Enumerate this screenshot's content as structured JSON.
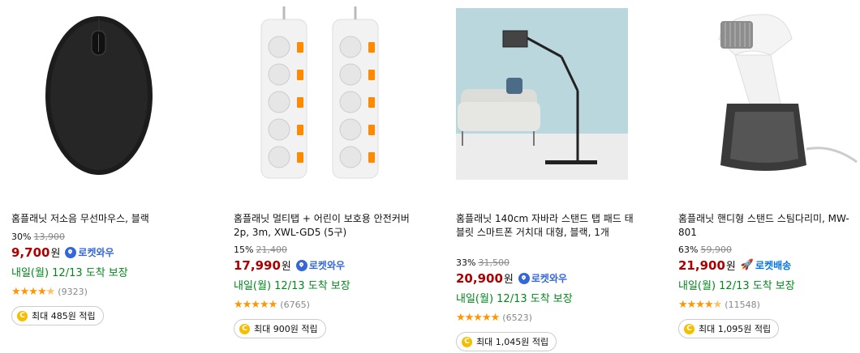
{
  "products": [
    {
      "image_icon": "wireless-mouse-image",
      "title": "홈플래닛 저소음 무선마우스, 블랙",
      "discount": "30%",
      "original_price": "13,900",
      "price": "9,700",
      "won": "원",
      "badge": "로켓와우",
      "delivery": "내일(월) 12/13 도착 보장",
      "rating": 4.5,
      "reviews": "(9323)",
      "reward": "최대 485원 적립"
    },
    {
      "image_icon": "power-strip-image",
      "title": "홈플래닛 멀티탭 + 어린이 보호용 안전커버 2p, 3m, XWL-GD5 (5구)",
      "discount": "15%",
      "original_price": "21,400",
      "price": "17,990",
      "won": "원",
      "badge": "로켓와우",
      "delivery": "내일(월) 12/13 도착 보장",
      "rating": 5,
      "reviews": "(6765)",
      "reward": "최대 900원 적립"
    },
    {
      "image_icon": "tablet-stand-image",
      "title": "홈플래닛 140cm 자바라 스탠드 탭 패드 태블릿 스마트폰 거치대 대형, 블랙, 1개",
      "discount": "33%",
      "original_price": "31,500",
      "price": "20,900",
      "won": "원",
      "badge": "로켓와우",
      "delivery": "내일(월) 12/13 도착 보장",
      "rating": 5,
      "reviews": "(6523)",
      "reward": "최대 1,045원 적립"
    },
    {
      "image_icon": "steamer-image",
      "title": "홈플래닛 핸디형 스탠드 스팀다리미, MW-801",
      "discount": "63%",
      "original_price": "59,900",
      "price": "21,900",
      "won": "원",
      "badge": "로켓배송",
      "delivery": "내일(월) 12/13 도착 보장",
      "rating": 4.5,
      "reviews": "(11548)",
      "reward": "최대 1,095원 적립"
    }
  ],
  "colors": {
    "price": "#ae0000",
    "delivery": "#00891a",
    "star": "#ff9600",
    "badge": "#3567d8"
  }
}
